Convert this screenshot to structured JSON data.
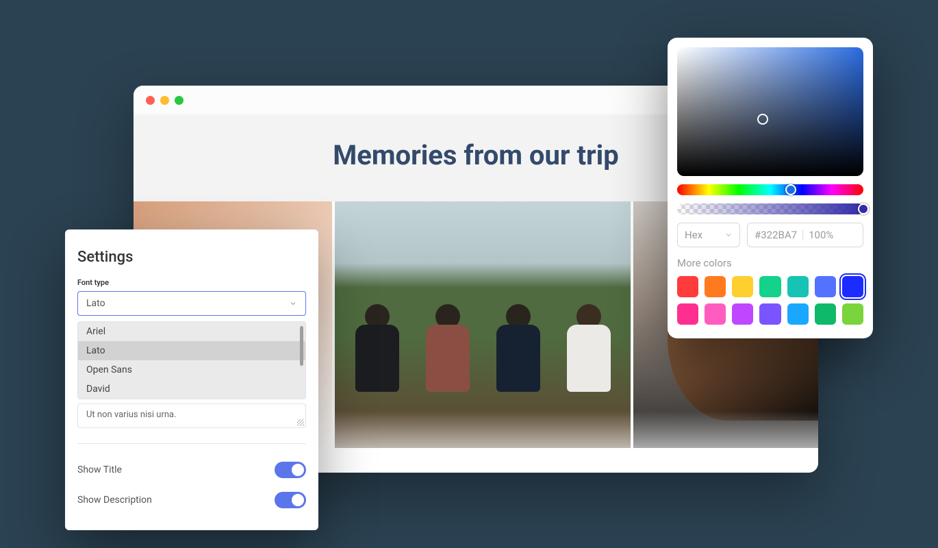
{
  "browser": {
    "title": "Memories from our trip"
  },
  "settings": {
    "panel_title": "Settings",
    "font_type_label": "Font type",
    "selected_font": "Lato",
    "font_options": [
      "Ariel",
      "Lato",
      "Open Sans",
      "David"
    ],
    "textarea_value": "Ut non varius nisi urna.",
    "toggle_title": {
      "label": "Show Title",
      "on": true
    },
    "toggle_description": {
      "label": "Show Description",
      "on": true
    }
  },
  "color_picker": {
    "format_label": "Hex",
    "hex_value": "#322BA7",
    "opacity": "100%",
    "more_colors_label": "More colors",
    "swatches_row1": [
      "#ff3b3b",
      "#ff7a1f",
      "#ffcf30",
      "#14d18b",
      "#17c3b2",
      "#5372ff",
      "#1c2bff"
    ],
    "swatches_row2": [
      "#ff2f92",
      "#ff5cc0",
      "#c046ff",
      "#7a55ff",
      "#1aa7ff",
      "#0fb96a",
      "#7ad43b"
    ],
    "selected_swatch": "#1c2bff"
  }
}
